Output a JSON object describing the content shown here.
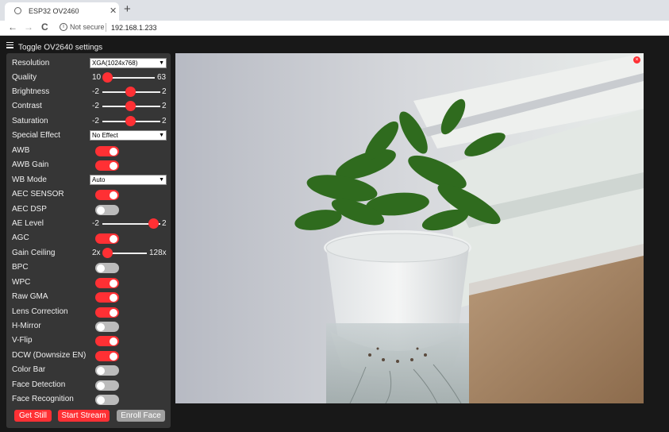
{
  "browser": {
    "tab_title": "ESP32 OV2460",
    "tab_close": "✕",
    "new_tab": "+",
    "back": "←",
    "forward": "→",
    "reload": "C",
    "security_text": "Not secure",
    "url": "192.168.1.233"
  },
  "page": {
    "toggle_settings": "Toggle OV2640 settings"
  },
  "settings": {
    "resolution": {
      "label": "Resolution",
      "value": "XGA(1024x768)"
    },
    "quality": {
      "label": "Quality",
      "min": "10",
      "max": "63",
      "level": 0
    },
    "brightness": {
      "label": "Brightness",
      "min": "-2",
      "max": "2",
      "level": 0.5
    },
    "contrast": {
      "label": "Contrast",
      "min": "-2",
      "max": "2",
      "level": 0.5
    },
    "saturation": {
      "label": "Saturation",
      "min": "-2",
      "max": "2",
      "level": 0.5
    },
    "special_effect": {
      "label": "Special Effect",
      "value": "No Effect"
    },
    "awb": {
      "label": "AWB",
      "on": true
    },
    "awb_gain": {
      "label": "AWB Gain",
      "on": true
    },
    "wb_mode": {
      "label": "WB Mode",
      "value": "Auto"
    },
    "aec_sensor": {
      "label": "AEC SENSOR",
      "on": true
    },
    "aec_dsp": {
      "label": "AEC DSP",
      "on": false
    },
    "ae_level": {
      "label": "AE Level",
      "min": "-2",
      "max": "2",
      "level": 1
    },
    "agc": {
      "label": "AGC",
      "on": true
    },
    "gain_ceiling": {
      "label": "Gain Ceiling",
      "min": "2x",
      "max": "128x",
      "level": 0
    },
    "bpc": {
      "label": "BPC",
      "on": false
    },
    "wpc": {
      "label": "WPC",
      "on": true
    },
    "raw_gma": {
      "label": "Raw GMA",
      "on": true
    },
    "lens_correction": {
      "label": "Lens Correction",
      "on": true
    },
    "h_mirror": {
      "label": "H-Mirror",
      "on": false
    },
    "v_flip": {
      "label": "V-Flip",
      "on": true
    },
    "dcw": {
      "label": "DCW (Downsize EN)",
      "on": true
    },
    "color_bar": {
      "label": "Color Bar",
      "on": false
    },
    "face_detection": {
      "label": "Face Detection",
      "on": false
    },
    "face_recognition": {
      "label": "Face Recognition",
      "on": false
    }
  },
  "buttons": {
    "get_still": "Get Still",
    "start_stream": "Start Stream",
    "enroll_face": "Enroll Face"
  },
  "stream": {
    "close_glyph": "×"
  },
  "colors": {
    "accent": "#ff3034",
    "panel": "#363636",
    "background": "#181818"
  }
}
